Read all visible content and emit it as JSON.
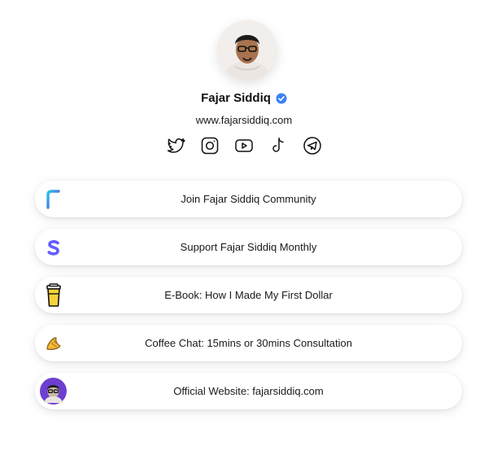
{
  "profile": {
    "name": "Fajar Siddiq",
    "verified": true,
    "website": "www.fajarsiddiq.com",
    "accent_color": "#3b82f6"
  },
  "socials": [
    {
      "icon": "twitter-icon"
    },
    {
      "icon": "instagram-icon"
    },
    {
      "icon": "youtube-icon"
    },
    {
      "icon": "tiktok-icon"
    },
    {
      "icon": "telegram-icon"
    }
  ],
  "links": [
    {
      "label": "Join Fajar Siddiq Community",
      "icon": "community-logo-icon",
      "color": "#2f6ce5"
    },
    {
      "label": "Support Fajar Siddiq Monthly",
      "icon": "stripe-s-icon",
      "color": "#635bff"
    },
    {
      "label": "E-Book: How I Made My First Dollar",
      "icon": "coffee-cup-icon",
      "color": "#f5c518"
    },
    {
      "label": "Coffee Chat: 15mins or 30mins Consultation",
      "icon": "croissant-icon",
      "color": "#e7b23a"
    },
    {
      "label": "Official Website: fajarsiddiq.com",
      "icon": "avatar-badge-icon",
      "color": "#6d3fd1"
    }
  ]
}
